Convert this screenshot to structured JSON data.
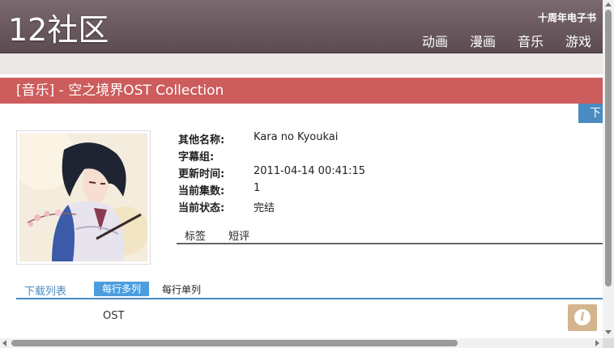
{
  "header": {
    "logo": "12社区",
    "ebook_link": "十周年电子书",
    "nav": [
      "动画",
      "漫画",
      "音乐",
      "游戏"
    ]
  },
  "title": "[音乐] - 空之境界OST Collection",
  "download_button": "下",
  "info": {
    "rows": [
      {
        "key": "其他名称:",
        "value": "Kara no Kyoukai"
      },
      {
        "key": "字幕组:",
        "value": ""
      },
      {
        "key": "更新时间:",
        "value": "2011-04-14 00:41:15"
      },
      {
        "key": "当前集数:",
        "value": "1"
      },
      {
        "key": "当前状态:",
        "value": "完结"
      }
    ]
  },
  "tabs": [
    "标签",
    "短评"
  ],
  "list": {
    "label": "下载列表",
    "multi": "每行多列",
    "single": "每行单列",
    "items": [
      "OST"
    ]
  },
  "icons": {
    "info": "info-icon",
    "cover": "anime-cover-image"
  },
  "colors": {
    "header": "#6b5a60",
    "title_bar": "#cd5c5c",
    "accent_blue": "#4a8bc2",
    "info_button": "#d4b48e"
  }
}
